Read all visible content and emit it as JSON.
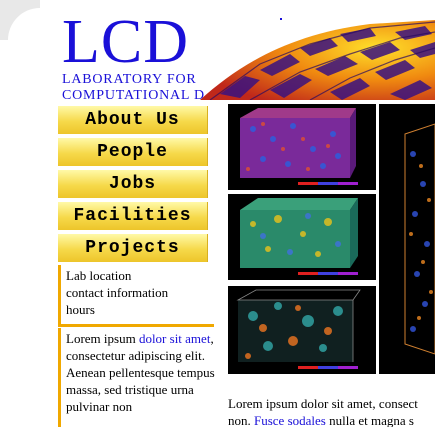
{
  "logo": {
    "title": "LCD",
    "line1": "LABORATORY FOR",
    "line2": "COMPUTATIONAL D"
  },
  "nav": {
    "items": [
      "About Us",
      "People",
      "Jobs",
      "Facilities",
      "Projects"
    ]
  },
  "info": {
    "lines": [
      "Lab location",
      "contact information",
      "hours"
    ]
  },
  "sidebar_text": {
    "pre": "Lorem ipsum ",
    "link": "dolor sit amet",
    "post": ", consectetur adipiscing elit. Aenean pellentesque tempus massa, sed tristique urna pulvinar non"
  },
  "main_text": {
    "line1": "Lorem ipsum dolor sit amet, consect",
    "line2_pre": "non. ",
    "line2_link": "Fusce sodales",
    "line2_post": " nulla et magna s"
  },
  "colors": {
    "brand_blue": "#1a10d8",
    "nav_yellow": "#f6d94a",
    "accent_orange": "#f0a800"
  }
}
